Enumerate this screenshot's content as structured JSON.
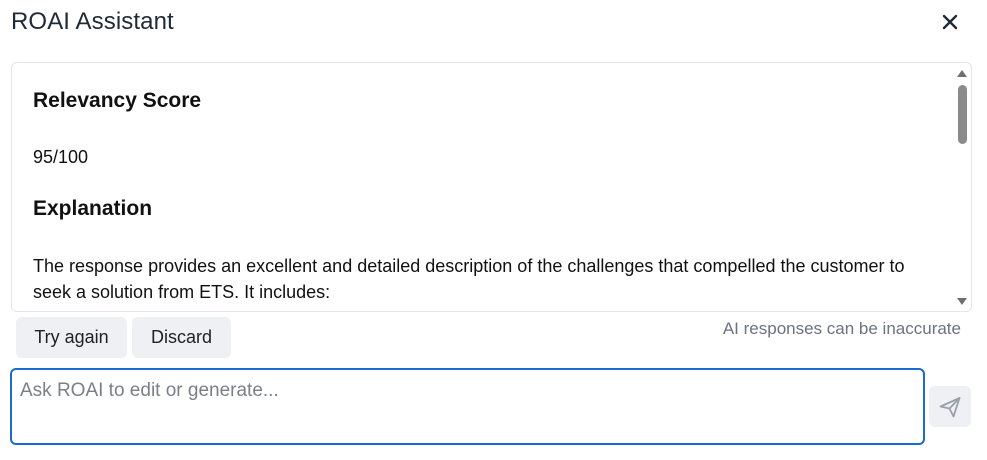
{
  "header": {
    "title": "ROAI Assistant",
    "close_icon": "close-icon"
  },
  "response": {
    "relevancy_heading": "Relevancy Score",
    "score": "95/100",
    "explanation_heading": "Explanation",
    "explanation_text": "The response provides an excellent and detailed description of the challenges that compelled the customer to seek a solution from ETS. It includes:"
  },
  "actions": {
    "try_again_label": "Try again",
    "discard_label": "Discard"
  },
  "disclaimer": "AI responses can be inaccurate",
  "prompt": {
    "value": "",
    "placeholder": "Ask ROAI to edit or generate...",
    "send_icon": "send-icon"
  },
  "colors": {
    "accent": "#1a6bd1",
    "button_bg": "#eef0f3",
    "muted_text": "#6b7280"
  }
}
